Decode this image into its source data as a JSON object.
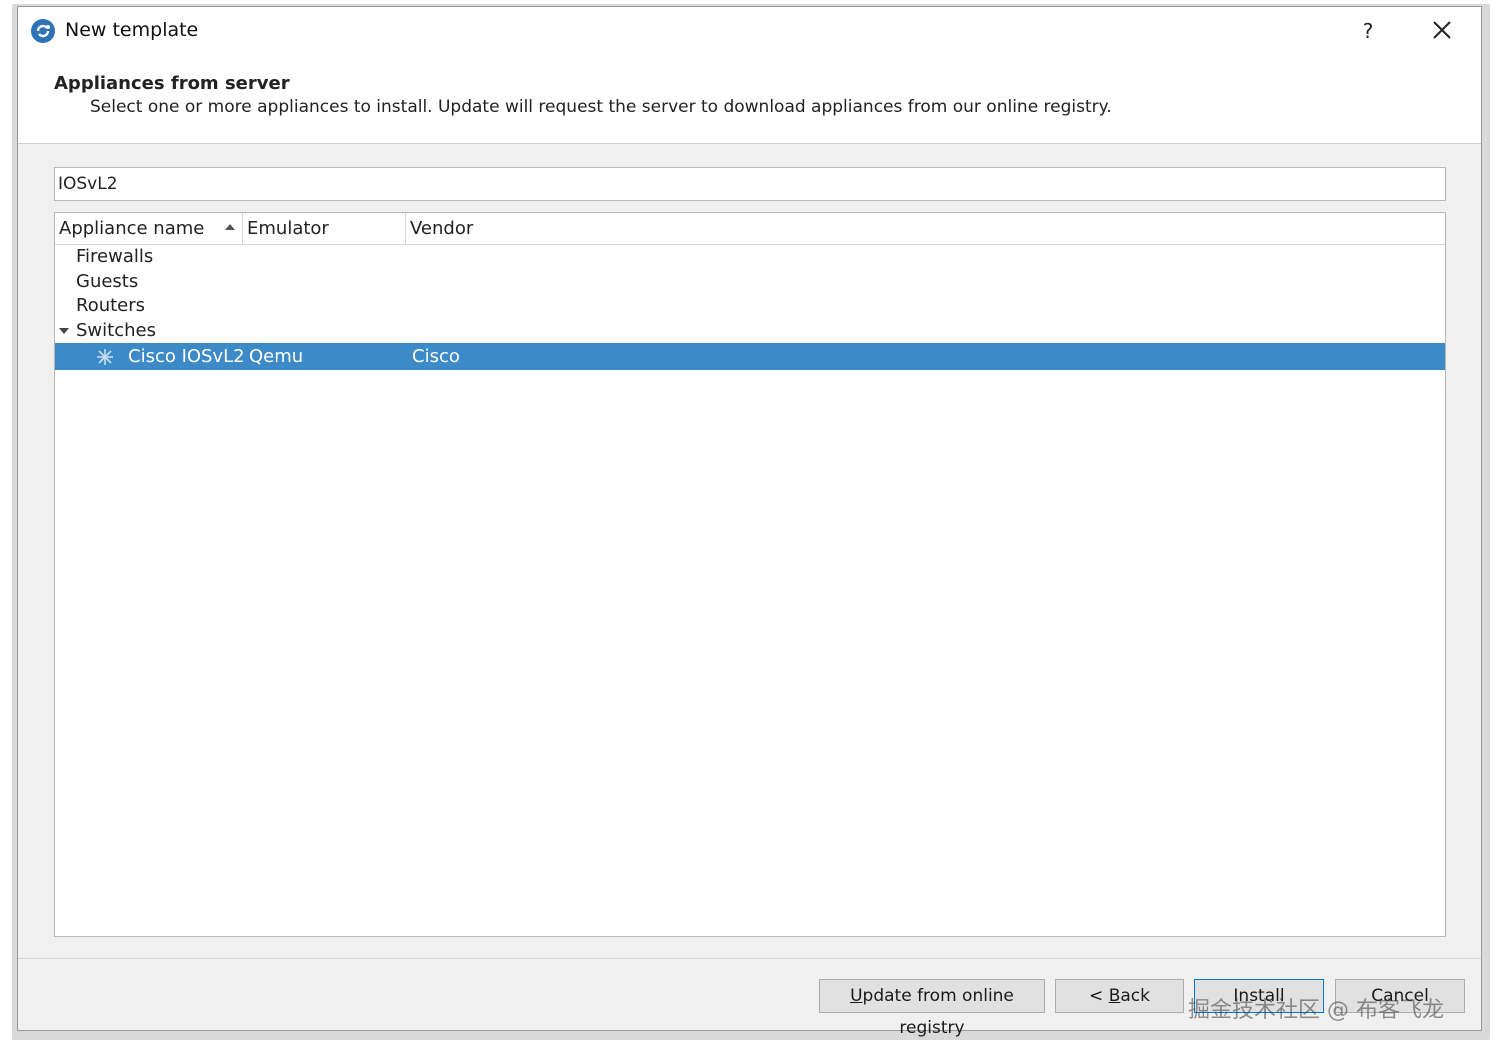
{
  "window": {
    "title": "New template",
    "help_label": "?",
    "icons": {
      "app": "gns3-app-icon",
      "close": "close-icon"
    }
  },
  "header": {
    "title": "Appliances from server",
    "subtitle": "Select one or more appliances to install. Update will request the server to download appliances from our online registry."
  },
  "search": {
    "value": "IOSvL2"
  },
  "table": {
    "columns": [
      "Appliance name",
      "Emulator",
      "Vendor"
    ],
    "sort_column": "Appliance name",
    "sort_order": "ascending",
    "categories": [
      {
        "label": "Firewalls",
        "expanded": false
      },
      {
        "label": "Guests",
        "expanded": false
      },
      {
        "label": "Routers",
        "expanded": false
      },
      {
        "label": "Switches",
        "expanded": true
      }
    ],
    "selected_row": {
      "name": "Cisco IOSvL2",
      "emulator": "Qemu",
      "vendor": "Cisco",
      "icon": "switch-icon"
    }
  },
  "buttons": {
    "update": {
      "label": "Update from online registry",
      "mnemonic": "U",
      "rest": "pdate from online registry"
    },
    "back": {
      "label": "< Back",
      "prefix": "< ",
      "mnemonic": "B",
      "rest": "ack"
    },
    "install": {
      "label": "Install"
    },
    "cancel": {
      "label": "Cancel"
    }
  },
  "watermark": "掘金技术社区 @ 布客飞龙",
  "colors": {
    "selection": "#3c8ac8",
    "default_button_border": "#0078d7"
  }
}
